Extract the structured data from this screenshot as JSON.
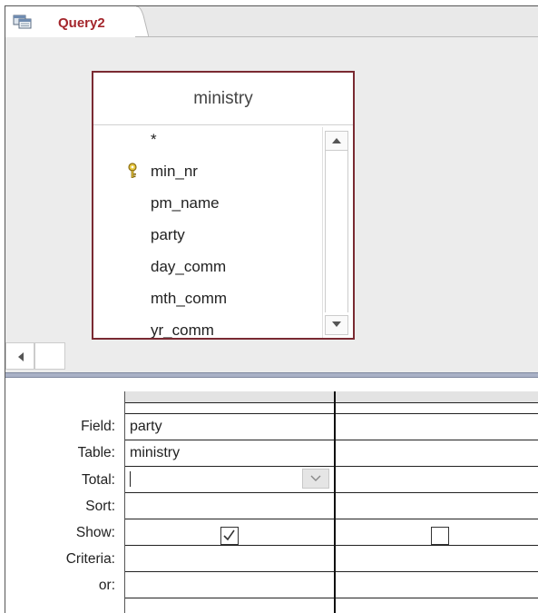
{
  "tab": {
    "label": "Query2",
    "icon": "query-icon"
  },
  "table": {
    "title": "ministry",
    "fields": [
      "*",
      "min_nr",
      "pm_name",
      "party",
      "day_comm",
      "mth_comm",
      "yr_comm"
    ],
    "primary_key_field": "min_nr"
  },
  "grid": {
    "row_labels": [
      "Field:",
      "Table:",
      "Total:",
      "Sort:",
      "Show:",
      "Criteria:",
      "or:"
    ],
    "columns": [
      {
        "field": "party",
        "table": "ministry",
        "total": "",
        "sort": "",
        "show": true,
        "criteria": "",
        "or": ""
      },
      {
        "field": "",
        "table": "",
        "total": "",
        "sort": "",
        "show": false,
        "criteria": "",
        "or": ""
      }
    ]
  },
  "colors": {
    "tab_label": "#a4262c",
    "table_border": "#7a2a32",
    "splitter": "#a9b1c6",
    "pane_background": "#ececec"
  }
}
